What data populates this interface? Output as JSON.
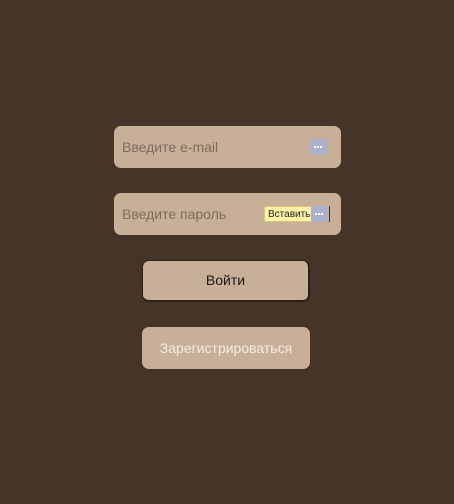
{
  "form": {
    "email": {
      "placeholder": "Введите e-mail",
      "value": "",
      "password_manager_icon": "password-manager-icon"
    },
    "password": {
      "placeholder": "Введите пароль",
      "value": "",
      "paste_tooltip": "Вставить",
      "password_manager_icon": "password-manager-icon"
    },
    "login_label": "Войти",
    "register_label": "Зарегистрироваться"
  },
  "colors": {
    "background": "#463429",
    "field": "#c8b098",
    "paste_tooltip": "#fff1a8"
  }
}
